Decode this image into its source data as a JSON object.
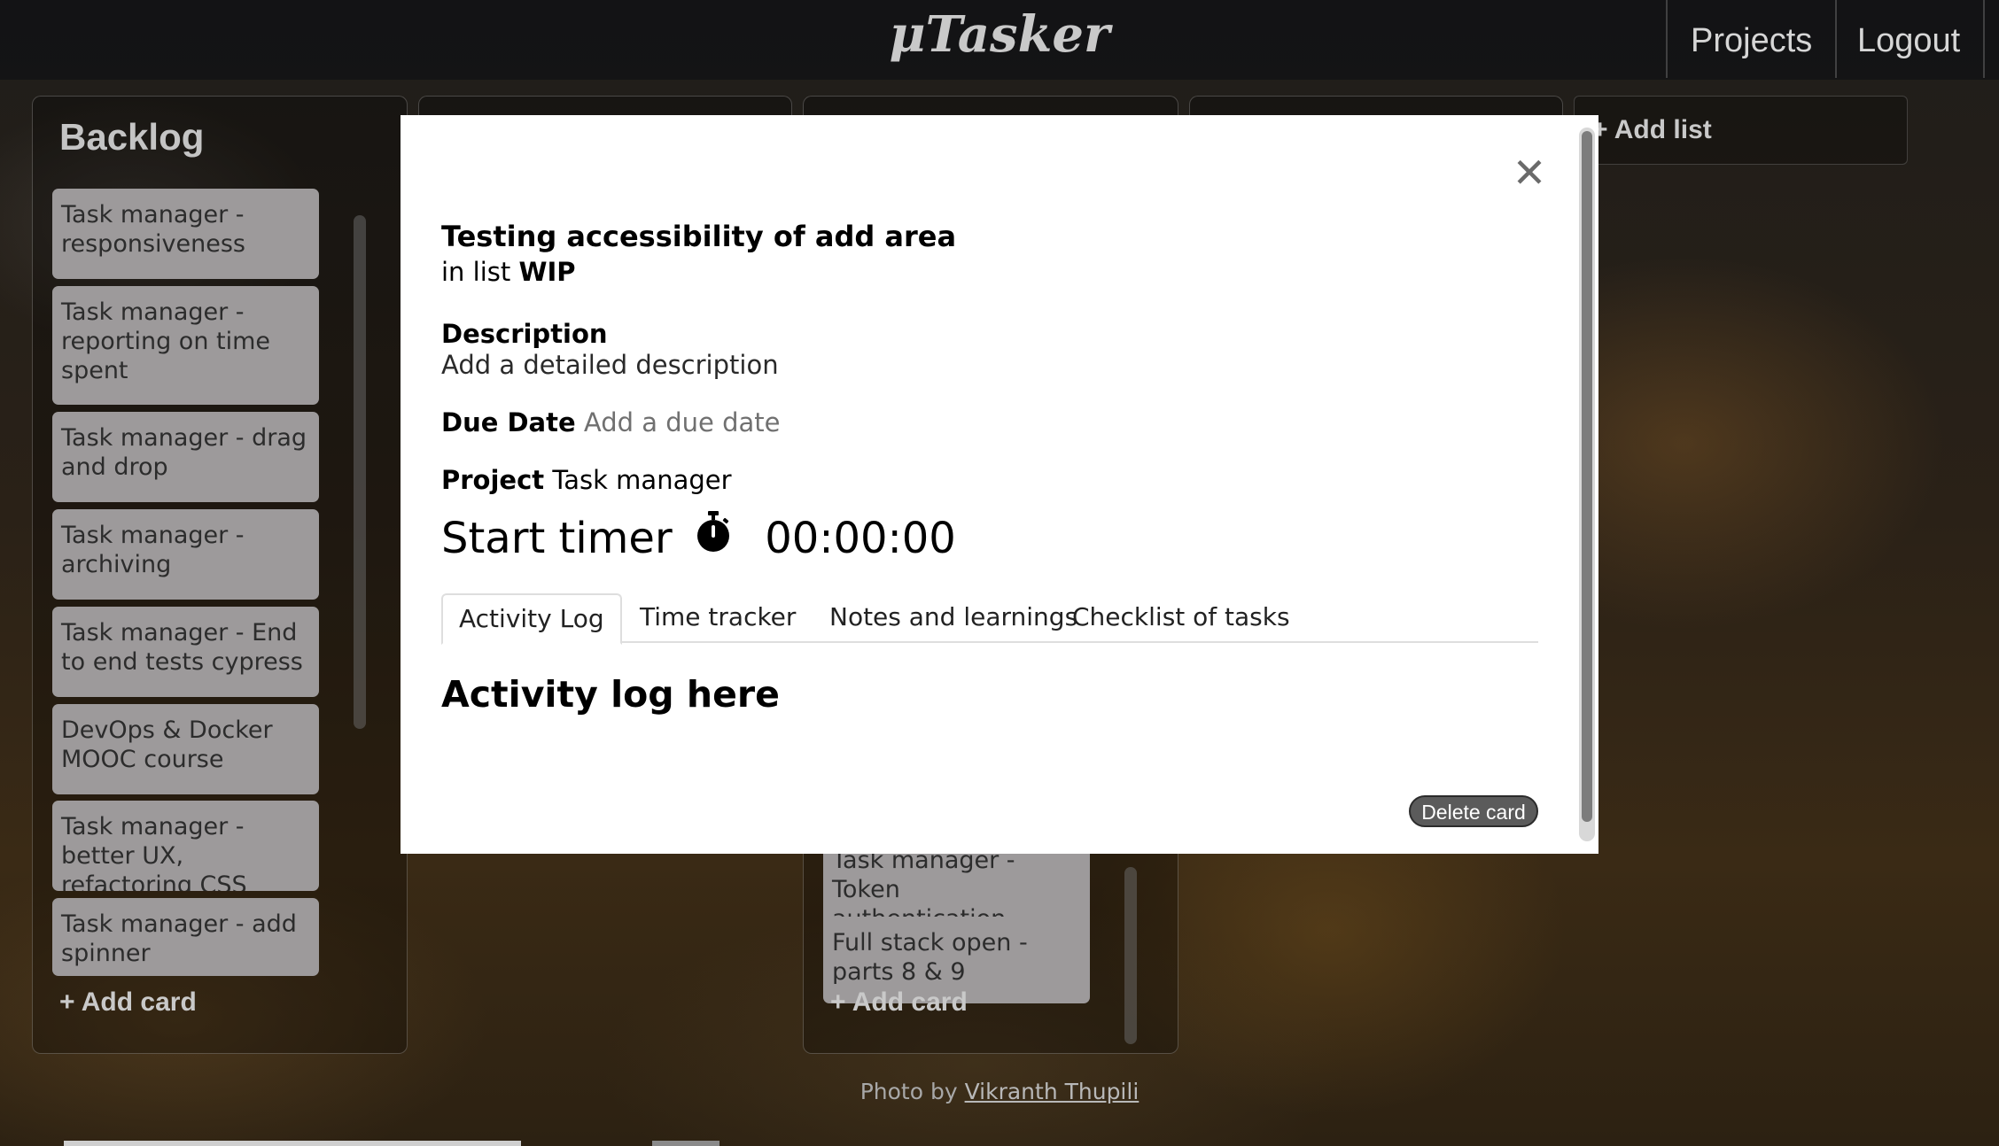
{
  "header": {
    "logo": "μTasker",
    "nav": {
      "projects": "Projects",
      "logout": "Logout"
    }
  },
  "lists": {
    "backlog": {
      "title": "Backlog",
      "cards": [
        "Task manager - responsiveness",
        "Task manager - reporting on time spent",
        "Task manager - drag and drop",
        "Task manager - archiving",
        "Task manager - End to end tests cypress",
        "DevOps & Docker MOOC course",
        "Task manager - better UX, refactoring CSS",
        "Task manager - add spinner"
      ],
      "add_card": "Add card"
    },
    "third": {
      "cards": [
        "Task manager - Token authentication",
        "Full stack open - parts 8 & 9"
      ],
      "add_card": "Add card"
    },
    "add_list": "Add list"
  },
  "photo_credit": {
    "prefix": "Photo by ",
    "author": "Vikranth Thupili"
  },
  "modal": {
    "close_symbol": "✕",
    "card_title": "Testing accessibility of add area",
    "in_list_prefix": "in list ",
    "list_name": "WIP",
    "description_label": "Description",
    "description_value": "Add a detailed description",
    "due_date_label": "Due Date",
    "due_date_placeholder": "Add a due date",
    "project_label": "Project",
    "project_value": "Task manager",
    "timer_label": "Start timer",
    "timer_value": "00:00:00",
    "tabs": [
      "Activity Log",
      "Time tracker",
      "Notes and learnings",
      "Checklist of tasks"
    ],
    "active_tab": "Activity Log",
    "tab_content": "Activity log here",
    "delete_label": "Delete card"
  }
}
